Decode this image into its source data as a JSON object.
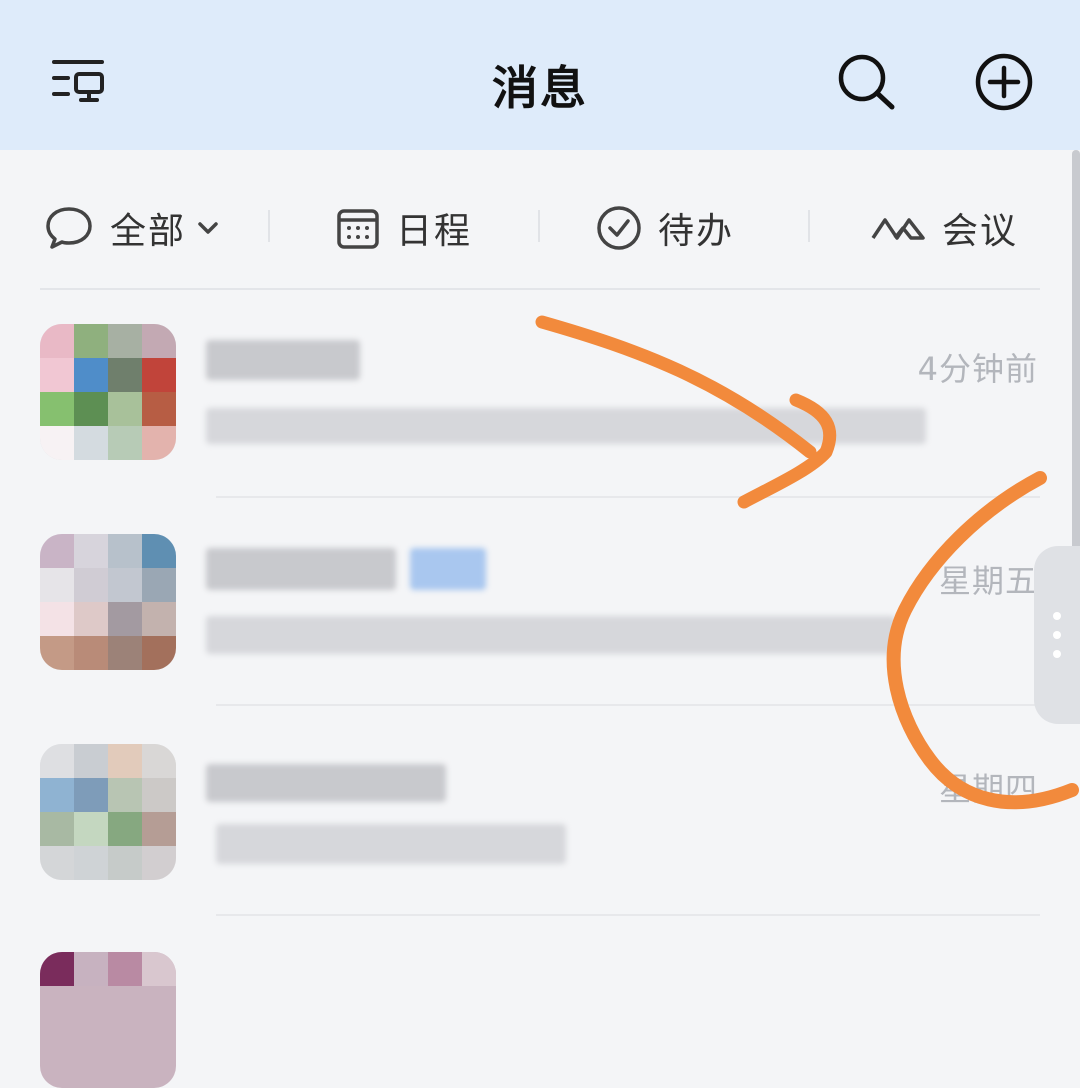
{
  "header": {
    "title": "消息",
    "menu_icon": "list-monitor-icon",
    "search_icon": "search-icon",
    "add_icon": "plus-circle-icon"
  },
  "filters": [
    {
      "label": "全部",
      "icon": "chat-bubble-icon",
      "has_dropdown": true
    },
    {
      "label": "日程",
      "icon": "calendar-icon"
    },
    {
      "label": "待办",
      "icon": "check-circle-icon"
    },
    {
      "label": "会议",
      "icon": "meeting-icon"
    }
  ],
  "conversations": [
    {
      "time": "4分钟前"
    },
    {
      "time": "星期五"
    },
    {
      "time": "星期四"
    }
  ],
  "colors": {
    "header_bg": "#deebfa",
    "page_bg": "#f4f5f7",
    "annotation": "#f28a3c"
  }
}
